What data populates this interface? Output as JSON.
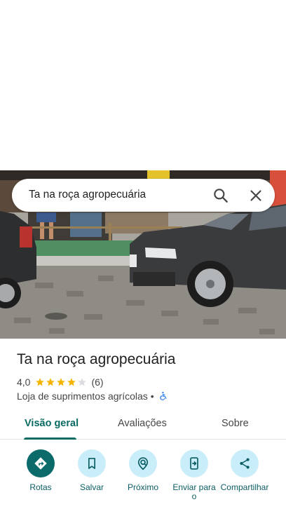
{
  "search": {
    "query": "Ta na roça agropecuária"
  },
  "place": {
    "name": "Ta na roça agropecuária",
    "rating": "4,0",
    "stars": 4,
    "review_count": "(6)",
    "category": "Loja de suprimentos agrícolas",
    "separator": "•"
  },
  "tabs": [
    {
      "label": "Visão geral",
      "active": true
    },
    {
      "label": "Avaliações",
      "active": false
    },
    {
      "label": "Sobre",
      "active": false
    }
  ],
  "actions": [
    {
      "label": "Rotas",
      "icon": "directions-icon"
    },
    {
      "label": "Salvar",
      "icon": "bookmark-icon"
    },
    {
      "label": "Próximo",
      "icon": "nearby-icon"
    },
    {
      "label": "Enviar para o",
      "icon": "send-to-phone-icon"
    },
    {
      "label": "Compartilhar",
      "icon": "share-icon"
    }
  ],
  "colors": {
    "accent": "#0b6b63",
    "action_bg": "#c9eef9",
    "star": "#f5b400"
  }
}
